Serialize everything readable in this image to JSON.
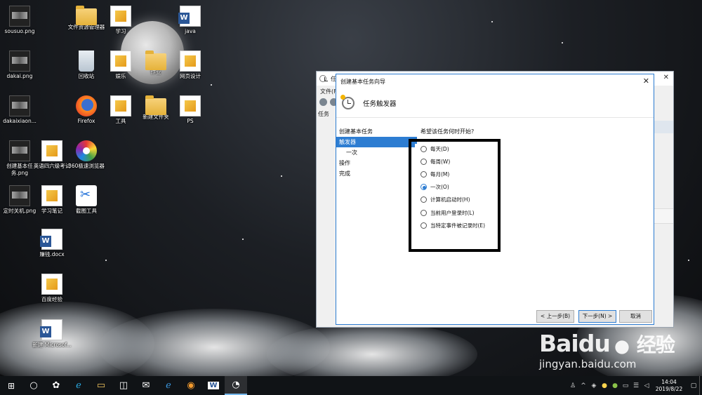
{
  "desktop_icons": [
    {
      "label": "sousuo.png"
    },
    {
      "label": "dakai.png"
    },
    {
      "label": "dakaixiaon..."
    },
    {
      "label": "创建基本任务.png"
    },
    {
      "label": "定时关机.png"
    },
    {
      "label": "英语四六级考试"
    },
    {
      "label": "学习笔记"
    },
    {
      "label": "赚钱.docx"
    },
    {
      "label": "百度经验"
    },
    {
      "label": "新建 Microsof..."
    },
    {
      "label": "文件资源管理器"
    },
    {
      "label": "回收站"
    },
    {
      "label": "Firefox"
    },
    {
      "label": "360极速浏览器"
    },
    {
      "label": "截图工具"
    },
    {
      "label": "学习"
    },
    {
      "label": "娱乐"
    },
    {
      "label": "工具"
    },
    {
      "label": "作业"
    },
    {
      "label": "新建文件夹"
    },
    {
      "label": "java"
    },
    {
      "label": "网页设计"
    },
    {
      "label": "PS"
    }
  ],
  "background_window": {
    "title": "任务",
    "menu": "文件(F",
    "tree": "任务"
  },
  "dialog": {
    "title": "创建基本任务向导",
    "heading": "任务触发器",
    "steps": [
      "创建基本任务",
      "触发器",
      "一次",
      "操作",
      "完成"
    ],
    "active_step": "触发器",
    "prompt": "希望该任务何时开始?",
    "options": [
      "每天(D)",
      "每周(W)",
      "每月(M)",
      "一次(O)",
      "计算机启动时(H)",
      "当前用户登录时(L)",
      "当特定事件被记录时(E)"
    ],
    "selected_option": "一次(O)",
    "buttons": {
      "back": "< 上一步(B)",
      "next": "下一步(N) >",
      "cancel": "取消"
    },
    "accent_color": "#2d7dd2"
  },
  "taskbar": {
    "apps": [
      "task-view-icon",
      "file-explorer-icon",
      "store-icon",
      "mail-icon",
      "edge-icon",
      "360-browser-icon",
      "word-icon",
      "task-scheduler-icon"
    ],
    "active_app": "task-scheduler-icon",
    "clock_time": "14:04",
    "clock_date": "2019/8/22"
  },
  "watermark": {
    "logo": "Baidu",
    "logo_cn": "经验",
    "url": "jingyan.baidu.com"
  }
}
